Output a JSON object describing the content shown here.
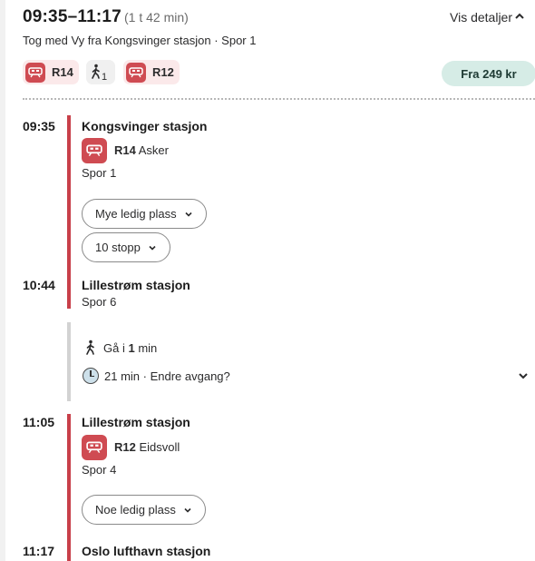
{
  "header": {
    "time_range": "09:35–11:17",
    "duration": "(1 t 42 min)",
    "details_label": "Vis detaljer",
    "subtitle": "Tog med Vy fra Kongsvinger stasjon · Spor 1"
  },
  "chips": [
    {
      "label": "R14",
      "icon": "train-icon"
    },
    {
      "walk_count": "1",
      "icon": "walk-icon"
    },
    {
      "label": "R12",
      "icon": "train-icon"
    }
  ],
  "price_label": "Fra 249 kr",
  "legs": [
    {
      "dep_time": "09:35",
      "from": "Kongsvinger stasjon",
      "line": "R14",
      "destination": "Asker",
      "platform": "Spor 1",
      "occupancy": "Mye ledig plass",
      "stops": "10 stopp",
      "arr_time": "10:44",
      "to": "Lillestrøm stasjon",
      "arr_platform": "Spor 6"
    },
    {
      "dep_time": "11:05",
      "from": "Lillestrøm stasjon",
      "line": "R12",
      "destination": "Eidsvoll",
      "platform": "Spor 4",
      "occupancy": "Noe ledig plass",
      "arr_time": "11:17",
      "to": "Oslo lufthavn stasjon"
    }
  ],
  "transfer": {
    "walk_prefix": "Gå i ",
    "walk_minutes": "1",
    "walk_suffix": " min",
    "wait_text": "21 min · Endre avgang?"
  },
  "colors": {
    "accent_red": "#c8404a",
    "price_bg": "#d6ece6"
  }
}
